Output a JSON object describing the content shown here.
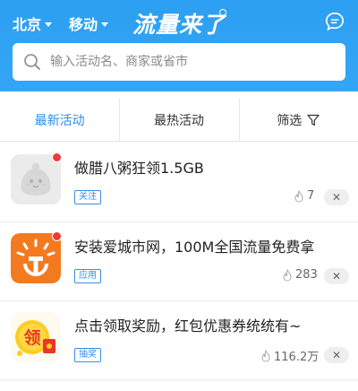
{
  "header": {
    "city": "北京",
    "carrier": "移动",
    "logo": "流量来了",
    "search_placeholder": "输入活动名、商家或省市"
  },
  "tabs": [
    {
      "label": "最新活动",
      "active": true
    },
    {
      "label": "最热活动",
      "active": false
    },
    {
      "label": "筛选",
      "active": false
    }
  ],
  "items": [
    {
      "title": "做腊八粥狂领1.5GB",
      "tag": "关注",
      "count": "7",
      "close": "✕",
      "icon": "mascot-icon",
      "unread": true
    },
    {
      "title": "安装爱城市网，100M全国流量免费拿",
      "tag": "应用",
      "count": "283",
      "close": "✕",
      "icon": "city-app-icon",
      "unread": true
    },
    {
      "title": "点击领取奖励，红包优惠券统统有~",
      "tag": "抽奖",
      "count": "116.2万",
      "close": "✕",
      "icon": "reward-icon",
      "unread": false
    }
  ],
  "colors": {
    "primary": "#2a8ee8",
    "header": "#35a6f5",
    "badge": "#ee3b3b"
  }
}
